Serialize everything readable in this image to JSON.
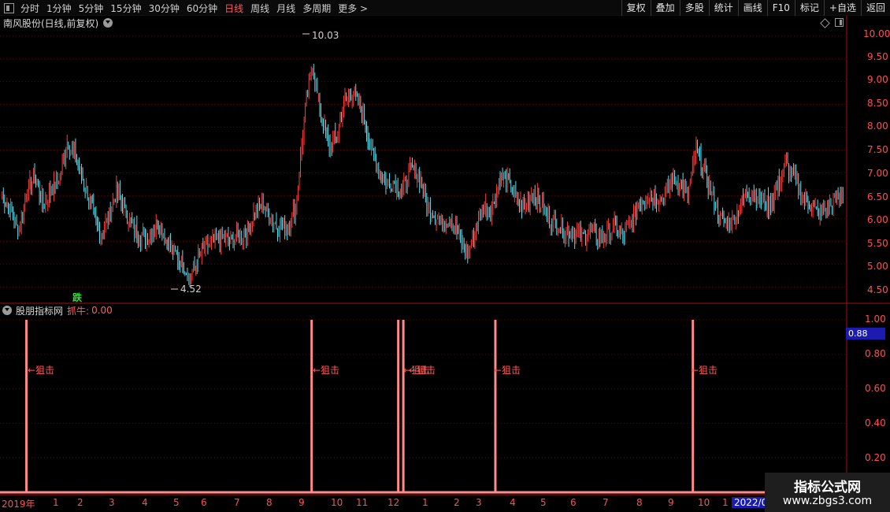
{
  "toolbar": {
    "periods": [
      "分时",
      "1分钟",
      "5分钟",
      "15分钟",
      "30分钟",
      "60分钟",
      "日线",
      "周线",
      "月线",
      "多周期",
      "更多 >"
    ],
    "active_period": "日线",
    "right_buttons": [
      "复权",
      "叠加",
      "多股",
      "统计",
      "画线",
      "F10",
      "标记",
      "+自选",
      "返回"
    ]
  },
  "main_chart": {
    "title": "南风股份(日线,前复权)",
    "high_label": "10.03",
    "low_label": "4.52",
    "signal_text": "跌",
    "price_axis": [
      "10.00",
      "9.50",
      "9.00",
      "8.50",
      "8.00",
      "7.50",
      "7.00",
      "6.50",
      "6.00",
      "5.50",
      "5.00",
      "4.50"
    ]
  },
  "indicator": {
    "name": "股朋指标网",
    "line_name": "抓牛:",
    "line_value": "0.00",
    "axis": [
      "1.00",
      "0.80",
      "0.60",
      "0.40",
      "0.20"
    ],
    "current_value": "0.88",
    "signal_label": "←狙击"
  },
  "date_axis": {
    "labels": [
      "2019年",
      "1",
      "2",
      "3",
      "4",
      "5",
      "6",
      "7",
      "8",
      "9",
      "10",
      "11",
      "12",
      "1",
      "2",
      "3",
      "4",
      "5",
      "6",
      "7",
      "8",
      "9",
      "10",
      "1"
    ],
    "last_label": "2022/01"
  },
  "watermark": {
    "title": "指标公式网",
    "url": "www.zbgs3.com"
  },
  "chart_data": {
    "type": "candlestick",
    "title": "南风股份(日线,前复权)",
    "price_ylim": [
      4.4,
      10.1
    ],
    "price_close": [
      6.5,
      6.2,
      5.7,
      6.6,
      6.9,
      6.3,
      6.6,
      6.9,
      7.7,
      7.3,
      6.8,
      6.2,
      5.6,
      6.0,
      6.6,
      6.2,
      5.8,
      5.6,
      5.6,
      5.9,
      5.6,
      5.3,
      5.0,
      4.7,
      5.1,
      5.4,
      5.5,
      5.6,
      5.5,
      5.6,
      5.7,
      6.2,
      6.3,
      6.0,
      5.8,
      5.8,
      6.3,
      8.2,
      9.4,
      8.3,
      7.6,
      7.8,
      8.6,
      8.8,
      8.4,
      7.7,
      7.1,
      6.8,
      6.8,
      6.6,
      7.1,
      7.0,
      6.3,
      6.1,
      5.9,
      6.0,
      5.6,
      5.2,
      5.7,
      6.3,
      6.2,
      6.9,
      6.8,
      6.4,
      6.2,
      6.6,
      6.3,
      6.0,
      5.9,
      5.7,
      5.7,
      5.6,
      5.7,
      5.6,
      5.6,
      5.8,
      5.6,
      5.9,
      6.3,
      6.5,
      6.5,
      6.4,
      6.9,
      6.8,
      6.5,
      7.5,
      7.0,
      6.5,
      6.0,
      5.9,
      6.1,
      6.5,
      6.6,
      6.4,
      6.3,
      6.7,
      7.2,
      6.9,
      6.5,
      6.3,
      6.1,
      6.2,
      6.4,
      6.6
    ],
    "indicator_series": {
      "name": "抓牛",
      "signal_positions": [
        0.0294,
        0.3669,
        0.4694,
        0.4754,
        0.5843,
        0.818
      ],
      "ylim": [
        0,
        1.05
      ]
    }
  }
}
